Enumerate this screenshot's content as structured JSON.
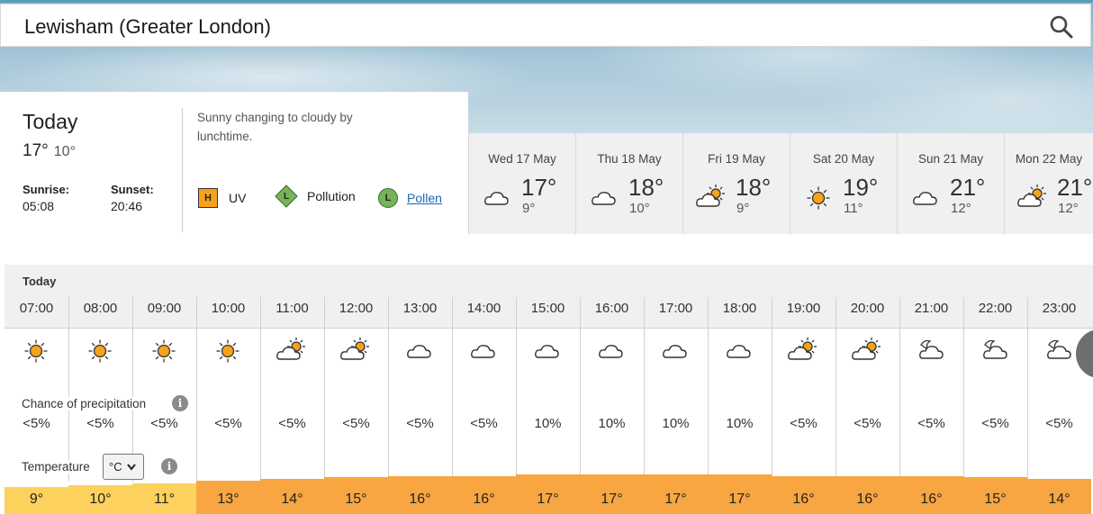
{
  "location": "Lewisham (Greater London)",
  "today": {
    "title": "Today",
    "max": "17°",
    "min": "10°",
    "sunrise_label": "Sunrise:",
    "sunrise": "05:08",
    "sunset_label": "Sunset:",
    "sunset": "20:46",
    "summary": "Sunny changing to cloudy by lunchtime.",
    "uv_badge": "H",
    "uv_label": "UV",
    "pollution_badge": "L",
    "pollution_label": "Pollution",
    "pollen_badge": "L",
    "pollen_label": "Pollen"
  },
  "days": [
    {
      "name": "Wed 17 May",
      "max": "17°",
      "min": "9°",
      "icon": "cloud-icon"
    },
    {
      "name": "Thu 18 May",
      "max": "18°",
      "min": "10°",
      "icon": "cloud-icon"
    },
    {
      "name": "Fri 19 May",
      "max": "18°",
      "min": "9°",
      "icon": "sunny-intervals-icon"
    },
    {
      "name": "Sat 20 May",
      "max": "19°",
      "min": "11°",
      "icon": "sun-icon"
    },
    {
      "name": "Sun 21 May",
      "max": "21°",
      "min": "12°",
      "icon": "cloud-icon"
    },
    {
      "name": "Mon 22 May",
      "max": "21°",
      "min": "12°",
      "icon": "sunny-intervals-icon"
    }
  ],
  "hourly": {
    "title": "Today",
    "precip_label": "Chance of precipitation",
    "temp_label": "Temperature",
    "unit": "°C",
    "hours": [
      {
        "time": "07:00",
        "icon": "sun-icon",
        "precip": "<5%",
        "temp": "9°",
        "temp_c": 9
      },
      {
        "time": "08:00",
        "icon": "sun-icon",
        "precip": "<5%",
        "temp": "10°",
        "temp_c": 10
      },
      {
        "time": "09:00",
        "icon": "sun-icon",
        "precip": "<5%",
        "temp": "11°",
        "temp_c": 11
      },
      {
        "time": "10:00",
        "icon": "sun-icon",
        "precip": "<5%",
        "temp": "13°",
        "temp_c": 13
      },
      {
        "time": "11:00",
        "icon": "sunny-intervals-icon",
        "precip": "<5%",
        "temp": "14°",
        "temp_c": 14
      },
      {
        "time": "12:00",
        "icon": "sunny-intervals-icon",
        "precip": "<5%",
        "temp": "15°",
        "temp_c": 15
      },
      {
        "time": "13:00",
        "icon": "cloud-icon",
        "precip": "<5%",
        "temp": "16°",
        "temp_c": 16
      },
      {
        "time": "14:00",
        "icon": "cloud-icon",
        "precip": "<5%",
        "temp": "16°",
        "temp_c": 16
      },
      {
        "time": "15:00",
        "icon": "cloud-icon",
        "precip": "10%",
        "temp": "17°",
        "temp_c": 17
      },
      {
        "time": "16:00",
        "icon": "cloud-icon",
        "precip": "10%",
        "temp": "17°",
        "temp_c": 17
      },
      {
        "time": "17:00",
        "icon": "cloud-icon",
        "precip": "10%",
        "temp": "17°",
        "temp_c": 17
      },
      {
        "time": "18:00",
        "icon": "cloud-icon",
        "precip": "10%",
        "temp": "17°",
        "temp_c": 17
      },
      {
        "time": "19:00",
        "icon": "sunny-intervals-icon",
        "precip": "<5%",
        "temp": "16°",
        "temp_c": 16
      },
      {
        "time": "20:00",
        "icon": "sunny-intervals-icon",
        "precip": "<5%",
        "temp": "16°",
        "temp_c": 16
      },
      {
        "time": "21:00",
        "icon": "partly-cloudy-night-icon",
        "precip": "<5%",
        "temp": "16°",
        "temp_c": 16
      },
      {
        "time": "22:00",
        "icon": "partly-cloudy-night-icon",
        "precip": "<5%",
        "temp": "15°",
        "temp_c": 15
      },
      {
        "time": "23:00",
        "icon": "partly-cloudy-night-icon",
        "precip": "<5%",
        "temp": "14°",
        "temp_c": 14
      }
    ]
  },
  "colors": {
    "sun": "#f7a21b",
    "uv_high": "#f7a21b",
    "pollution_low": "#76b35a",
    "link": "#1a66b3",
    "temp_cool": "#fcd25c",
    "temp_warm": "#f7a641"
  }
}
